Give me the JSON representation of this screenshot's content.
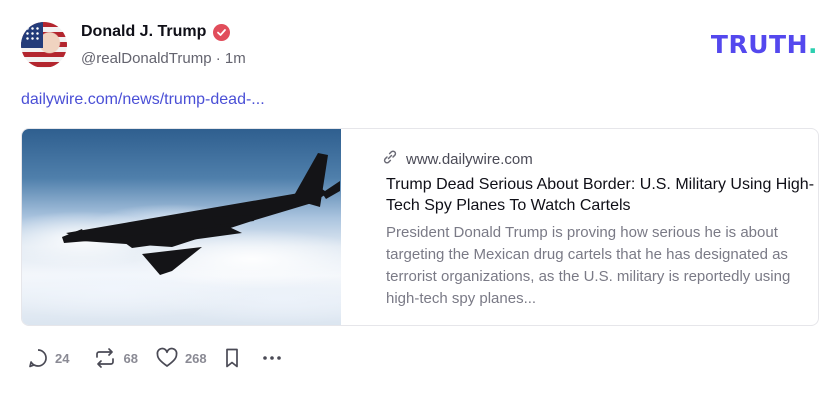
{
  "post": {
    "display_name": "Donald J. Trump",
    "handle": "@realDonaldTrump",
    "separator": "·",
    "time": "1m",
    "link_text": "dailywire.com/news/trump-dead-..."
  },
  "brand": {
    "logo_text": "TRUTH",
    "logo_dot": ".",
    "logo_color": "#5448ee",
    "logo_dot_color": "#2ccfb0"
  },
  "card": {
    "domain": "www.dailywire.com",
    "title": "Trump Dead Serious About Border: U.S. Military Using High-Tech Spy Planes To Watch Cartels",
    "description": "President Donald Trump is proving how serious he is about targeting the Mexican drug cartels that he has designated as terrorist organizations, as the U.S. military is reportedly using high-tech spy planes..."
  },
  "actions": {
    "replies": "24",
    "retruths": "68",
    "likes": "268"
  },
  "icons": [
    "verified-icon",
    "link-icon",
    "reply-icon",
    "retruth-icon",
    "like-icon",
    "bookmark-icon",
    "more-icon"
  ]
}
